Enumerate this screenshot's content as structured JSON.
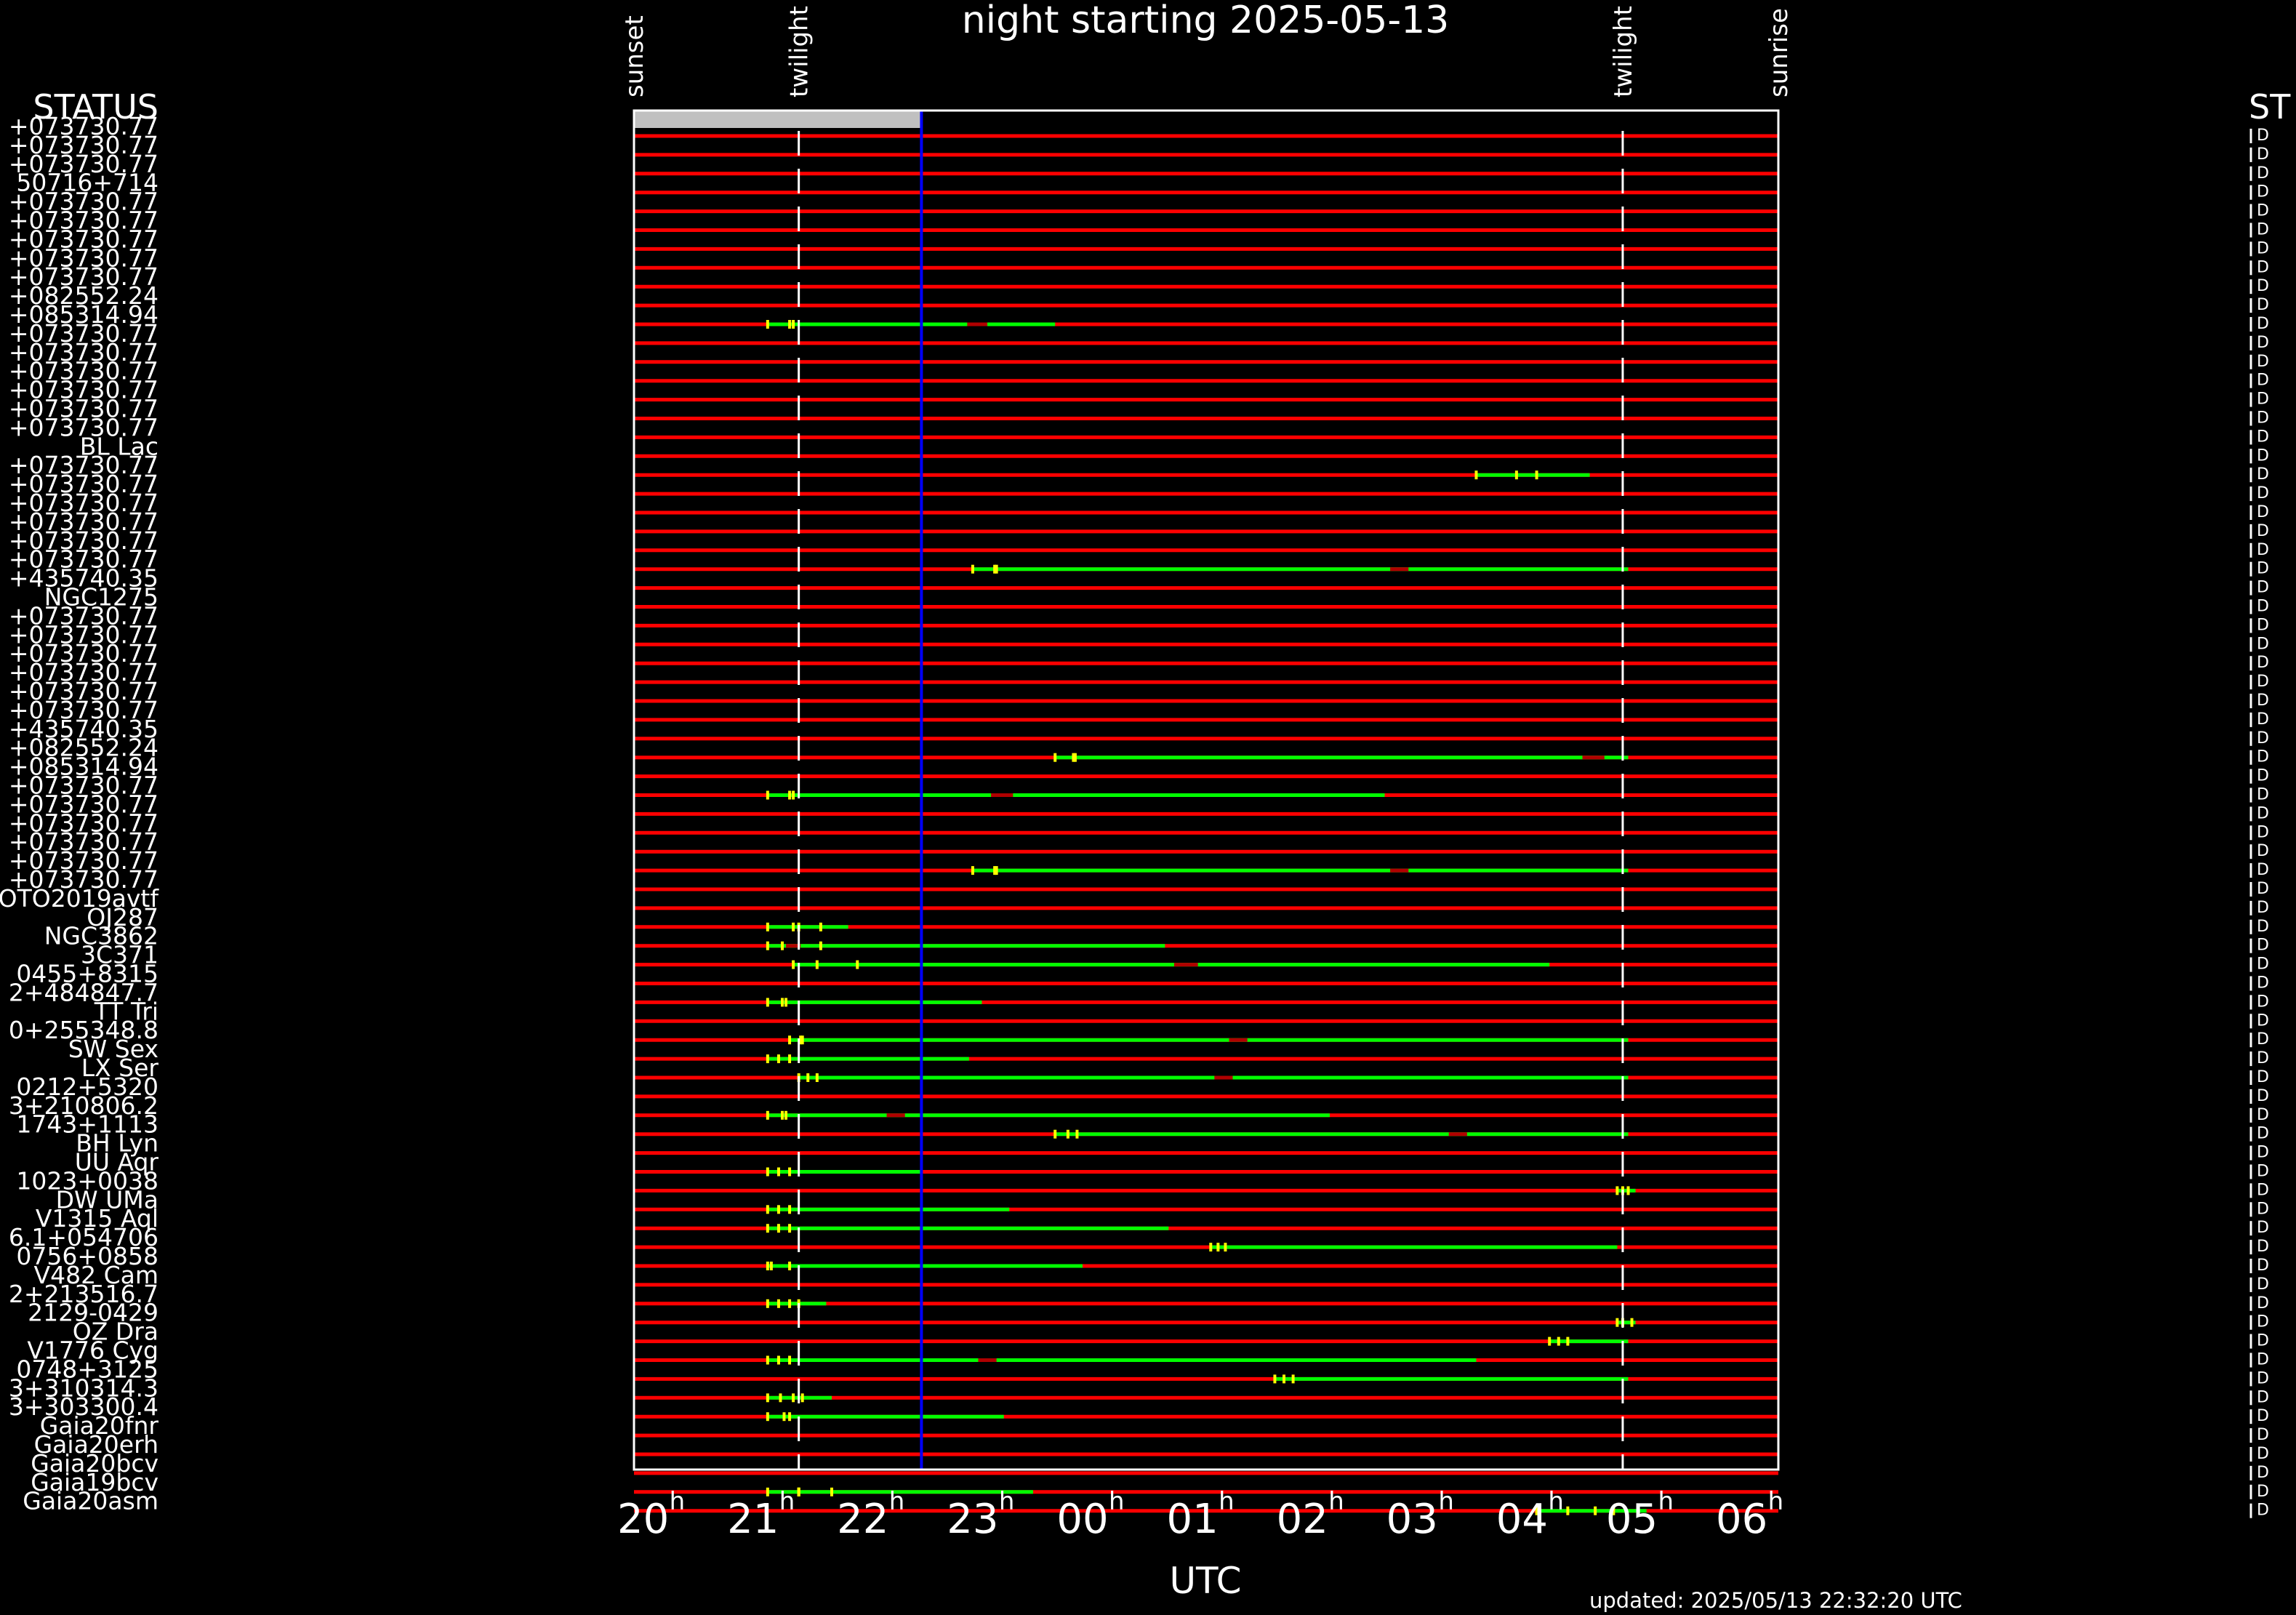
{
  "chart_data": {
    "type": "gantt",
    "title": "night starting 2025-05-13",
    "xlabel": "UTC",
    "updated": "updated: 2025/05/13 22:32:20 UTC",
    "status_header": "STATUS",
    "status_header_right": "ST",
    "status_marker": "D",
    "x_start": "19:55",
    "x_end": "06:20",
    "x_ticks": [
      {
        "hour": "20",
        "time": "20:00"
      },
      {
        "hour": "21",
        "time": "21:00"
      },
      {
        "hour": "22",
        "time": "22:00"
      },
      {
        "hour": "23",
        "time": "23:00"
      },
      {
        "hour": "00",
        "time": "00:00"
      },
      {
        "hour": "01",
        "time": "01:00"
      },
      {
        "hour": "02",
        "time": "02:00"
      },
      {
        "hour": "03",
        "time": "03:00"
      },
      {
        "hour": "04",
        "time": "04:00"
      },
      {
        "hour": "05",
        "time": "05:00"
      },
      {
        "hour": "06",
        "time": "06:00"
      }
    ],
    "tick_superscript": "h",
    "events": [
      {
        "label": "sunset",
        "time": "19:55"
      },
      {
        "label": "twilight",
        "time": "21:25"
      },
      {
        "label": "twilight",
        "time": "04:55"
      },
      {
        "label": "sunrise",
        "time": "06:20"
      }
    ],
    "twilight_times": [
      "21:25",
      "04:55"
    ],
    "current_time": "22:32",
    "elapsed_bar": {
      "from": "19:55",
      "to": "22:32"
    },
    "colors": {
      "background": "#000000",
      "unobservable": "#ff0000",
      "observable": "#00ff00",
      "marker": "#ffff00",
      "dark_gap": "#b00000",
      "current_time": "#0000ff",
      "elapsed": "#c0c0c0",
      "text": "#ffffff"
    },
    "rows": [
      {
        "label": "+073730.77",
        "windows": []
      },
      {
        "label": "+073730.77",
        "windows": []
      },
      {
        "label": "+073730.77",
        "windows": []
      },
      {
        "label": "50716+714",
        "windows": []
      },
      {
        "label": "+073730.77",
        "windows": []
      },
      {
        "label": "+073730.77",
        "windows": []
      },
      {
        "label": "+073730.77",
        "windows": []
      },
      {
        "label": "+073730.77",
        "windows": []
      },
      {
        "label": "+073730.77",
        "windows": []
      },
      {
        "label": "+082552.24",
        "windows": []
      },
      {
        "label": "+085314.94",
        "windows": [
          {
            "from": "21:08",
            "to": "23:45",
            "gaps": [
              [
                "22:57",
                "23:08"
              ]
            ],
            "marks": [
              "21:08",
              "21:20",
              "21:22"
            ]
          }
        ]
      },
      {
        "label": "+073730.77",
        "windows": []
      },
      {
        "label": "+073730.77",
        "windows": []
      },
      {
        "label": "+073730.77",
        "windows": []
      },
      {
        "label": "+073730.77",
        "windows": []
      },
      {
        "label": "+073730.77",
        "windows": []
      },
      {
        "label": "+073730.77",
        "windows": []
      },
      {
        "label": "BL Lac",
        "windows": []
      },
      {
        "label": "+073730.77",
        "windows": [
          {
            "from": "03:35",
            "to": "04:37",
            "gaps": [],
            "marks": [
              "03:35",
              "03:57",
              "04:08"
            ]
          }
        ]
      },
      {
        "label": "+073730.77",
        "windows": []
      },
      {
        "label": "+073730.77",
        "windows": []
      },
      {
        "label": "+073730.77",
        "windows": []
      },
      {
        "label": "+073730.77",
        "windows": []
      },
      {
        "label": "+073730.77",
        "windows": [
          {
            "from": "23:00",
            "to": "04:58",
            "gaps": [
              [
                "02:48",
                "02:58"
              ]
            ],
            "marks": [
              "23:00",
              "23:12",
              "23:13"
            ]
          }
        ]
      },
      {
        "label": "+435740.35",
        "windows": []
      },
      {
        "label": "NGC1275",
        "windows": []
      },
      {
        "label": "+073730.77",
        "windows": []
      },
      {
        "label": "+073730.77",
        "windows": []
      },
      {
        "label": "+073730.77",
        "windows": []
      },
      {
        "label": "+073730.77",
        "windows": []
      },
      {
        "label": "+073730.77",
        "windows": []
      },
      {
        "label": "+073730.77",
        "windows": []
      },
      {
        "label": "+435740.35",
        "windows": []
      },
      {
        "label": "+082552.24",
        "windows": [
          {
            "from": "23:45",
            "to": "04:58",
            "gaps": [
              [
                "04:33",
                "04:45"
              ]
            ],
            "marks": [
              "23:45",
              "23:55",
              "23:56"
            ]
          }
        ]
      },
      {
        "label": "+085314.94",
        "windows": []
      },
      {
        "label": "+073730.77",
        "windows": [
          {
            "from": "21:08",
            "to": "02:45",
            "gaps": [
              [
                "23:10",
                "23:22"
              ]
            ],
            "marks": [
              "21:08",
              "21:20",
              "21:22"
            ]
          }
        ]
      },
      {
        "label": "+073730.77",
        "windows": []
      },
      {
        "label": "+073730.77",
        "windows": []
      },
      {
        "label": "+073730.77",
        "windows": []
      },
      {
        "label": "+073730.77",
        "windows": [
          {
            "from": "23:00",
            "to": "04:58",
            "gaps": [
              [
                "02:48",
                "02:58"
              ]
            ],
            "marks": [
              "23:00",
              "23:12",
              "23:13"
            ]
          }
        ]
      },
      {
        "label": "+073730.77",
        "windows": []
      },
      {
        "label": "OTO2019avtf",
        "windows": []
      },
      {
        "label": "OJ287",
        "windows": [
          {
            "from": "21:08",
            "to": "21:52",
            "gaps": [],
            "marks": [
              "21:08",
              "21:22",
              "21:25",
              "21:37"
            ]
          }
        ]
      },
      {
        "label": "NGC3862",
        "windows": [
          {
            "from": "21:08",
            "to": "00:45",
            "gaps": [
              [
                "21:18",
                "21:26"
              ]
            ],
            "marks": [
              "21:08",
              "21:16",
              "21:37"
            ]
          }
        ]
      },
      {
        "label": "3C371",
        "windows": [
          {
            "from": "21:22",
            "to": "04:15",
            "gaps": [
              [
                "00:50",
                "01:03"
              ]
            ],
            "marks": [
              "21:22",
              "21:35",
              "21:57"
            ]
          }
        ]
      },
      {
        "label": "0455+8315",
        "windows": []
      },
      {
        "label": "2+484847.7",
        "windows": [
          {
            "from": "21:08",
            "to": "23:05",
            "gaps": [],
            "marks": [
              "21:08",
              "21:16",
              "21:18"
            ]
          }
        ]
      },
      {
        "label": "TT Tri",
        "windows": []
      },
      {
        "label": "0+255348.8",
        "windows": [
          {
            "from": "21:20",
            "to": "04:58",
            "gaps": [
              [
                "01:20",
                "01:30"
              ]
            ],
            "marks": [
              "21:20",
              "21:26",
              "21:27"
            ]
          }
        ]
      },
      {
        "label": "SW Sex",
        "windows": [
          {
            "from": "21:08",
            "to": "22:58",
            "gaps": [],
            "marks": [
              "21:08",
              "21:14",
              "21:20"
            ]
          }
        ]
      },
      {
        "label": "LX Ser",
        "windows": [
          {
            "from": "21:25",
            "to": "04:58",
            "gaps": [
              [
                "01:12",
                "01:22"
              ]
            ],
            "marks": [
              "21:25",
              "21:30",
              "21:35"
            ]
          }
        ]
      },
      {
        "label": "0212+5320",
        "windows": []
      },
      {
        "label": "3+210806.2",
        "windows": [
          {
            "from": "21:08",
            "to": "02:15",
            "gaps": [
              [
                "22:13",
                "22:23"
              ]
            ],
            "marks": [
              "21:08",
              "21:16",
              "21:18"
            ]
          }
        ]
      },
      {
        "label": "1743+1113",
        "windows": [
          {
            "from": "23:45",
            "to": "04:58",
            "gaps": [
              [
                "03:20",
                "03:30"
              ]
            ],
            "marks": [
              "23:45",
              "23:52",
              "23:57"
            ]
          }
        ]
      },
      {
        "label": "BH Lyn",
        "windows": []
      },
      {
        "label": "UU Aqr",
        "windows": [
          {
            "from": "21:08",
            "to": "22:32",
            "gaps": [],
            "marks": [
              "21:08",
              "21:14",
              "21:20"
            ]
          }
        ]
      },
      {
        "label": "1023+0038",
        "windows": [
          {
            "from": "04:52",
            "to": "05:02",
            "gaps": [],
            "marks": [
              "04:52",
              "04:55",
              "04:58"
            ]
          }
        ]
      },
      {
        "label": "DW UMa",
        "windows": [
          {
            "from": "21:08",
            "to": "23:20",
            "gaps": [],
            "marks": [
              "21:08",
              "21:14",
              "21:20"
            ]
          }
        ]
      },
      {
        "label": "V1315 Aql",
        "windows": [
          {
            "from": "21:08",
            "to": "00:47",
            "gaps": [],
            "marks": [
              "21:08",
              "21:14",
              "21:20"
            ]
          }
        ]
      },
      {
        "label": "6.1+054706",
        "windows": [
          {
            "from": "01:10",
            "to": "04:52",
            "gaps": [],
            "marks": [
              "01:10",
              "01:14",
              "01:18"
            ]
          }
        ]
      },
      {
        "label": "0756+0858",
        "windows": [
          {
            "from": "21:08",
            "to": "00:00",
            "gaps": [],
            "marks": [
              "21:08",
              "21:10",
              "21:20"
            ]
          }
        ]
      },
      {
        "label": "V482 Cam",
        "windows": []
      },
      {
        "label": "2+213516.7",
        "windows": [
          {
            "from": "21:08",
            "to": "21:40",
            "gaps": [],
            "marks": [
              "21:08",
              "21:14",
              "21:20",
              "21:25"
            ]
          }
        ]
      },
      {
        "label": "2129-0429",
        "windows": [
          {
            "from": "04:52",
            "to": "05:02",
            "gaps": [],
            "marks": [
              "04:52",
              "04:55",
              "05:00"
            ]
          }
        ]
      },
      {
        "label": "OZ Dra",
        "windows": [
          {
            "from": "04:15",
            "to": "04:58",
            "gaps": [],
            "marks": [
              "04:15",
              "04:20",
              "04:25"
            ]
          }
        ]
      },
      {
        "label": "V1776 Cyg",
        "windows": [
          {
            "from": "21:08",
            "to": "03:35",
            "gaps": [
              [
                "23:03",
                "23:13"
              ]
            ],
            "marks": [
              "21:08",
              "21:14",
              "21:20"
            ]
          }
        ]
      },
      {
        "label": "0748+3125",
        "windows": [
          {
            "from": "01:45",
            "to": "04:58",
            "gaps": [],
            "marks": [
              "01:45",
              "01:50",
              "01:55"
            ]
          }
        ]
      },
      {
        "label": "3+310314.3",
        "windows": [
          {
            "from": "21:08",
            "to": "21:43",
            "gaps": [],
            "marks": [
              "21:08",
              "21:15",
              "21:22",
              "21:27"
            ]
          }
        ]
      },
      {
        "label": "3+303300.4",
        "windows": [
          {
            "from": "21:08",
            "to": "23:17",
            "gaps": [],
            "marks": [
              "21:08",
              "21:17",
              "21:20"
            ]
          }
        ]
      },
      {
        "label": "Gaia20fnr",
        "windows": []
      },
      {
        "label": "Gaia20erh",
        "windows": []
      },
      {
        "label": "Gaia20bcv",
        "windows": []
      },
      {
        "label": "Gaia19bcv",
        "windows": [
          {
            "from": "21:08",
            "to": "23:33",
            "gaps": [],
            "marks": [
              "21:08",
              "21:25",
              "21:25",
              "21:25",
              "21:43"
            ]
          }
        ]
      },
      {
        "label": "Gaia20asm",
        "windows": [
          {
            "from": "04:08",
            "to": "05:08",
            "gaps": [],
            "marks": [
              "04:08",
              "04:25",
              "04:40",
              "04:50"
            ]
          }
        ]
      }
    ]
  }
}
